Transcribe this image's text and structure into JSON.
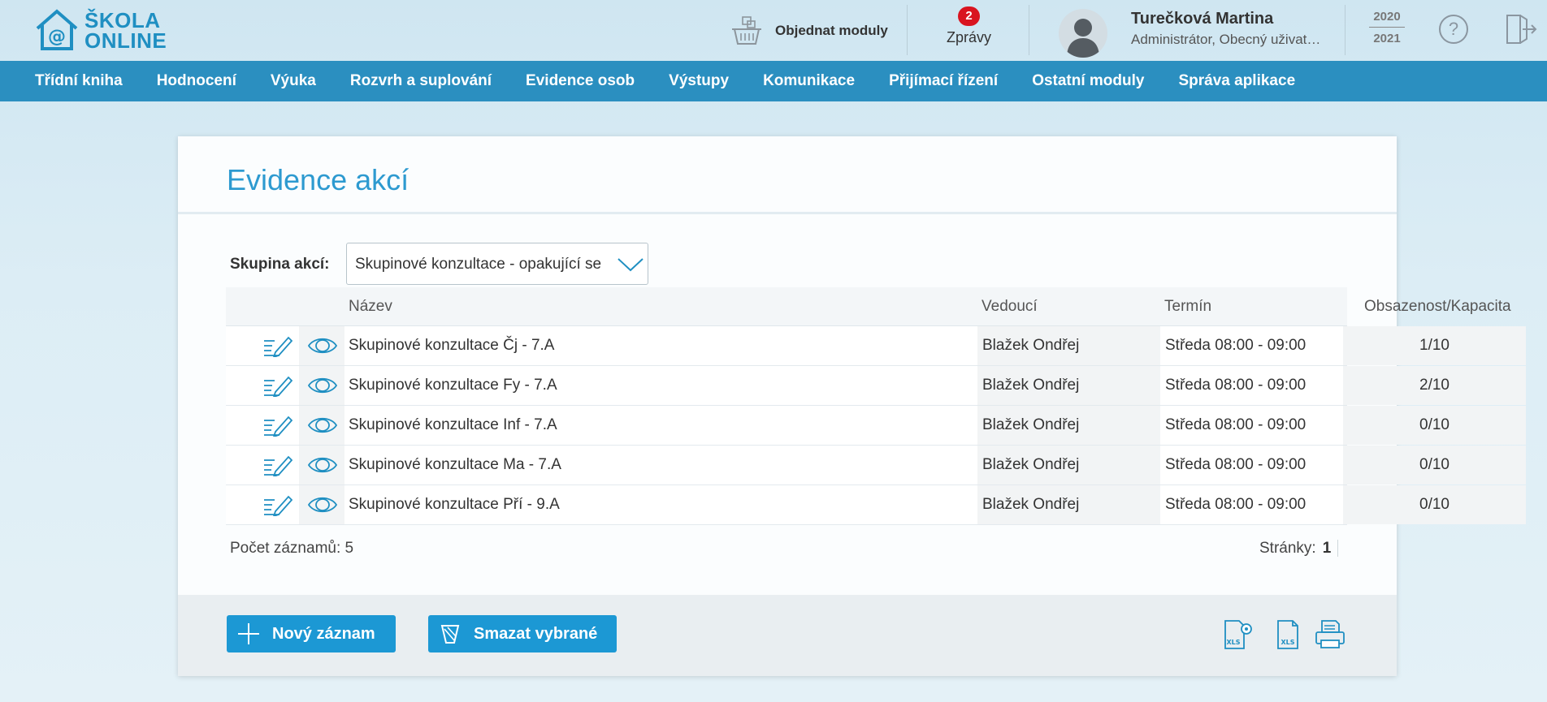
{
  "logo": {
    "line1": "ŠKOLA",
    "line2": "ONLINE"
  },
  "header": {
    "order_label": "Objednat moduly",
    "messages_badge": "2",
    "messages_label": "Zprávy",
    "user_name": "Turečková Martina",
    "user_role": "Administrátor, Obecný uživat…",
    "year_from": "2020",
    "year_to": "2021",
    "help_glyph": "?"
  },
  "nav": {
    "items": [
      "Třídní kniha",
      "Hodnocení",
      "Výuka",
      "Rozvrh a suplování",
      "Evidence osob",
      "Výstupy",
      "Komunikace",
      "Přijímací řízení",
      "Ostatní moduly",
      "Správa aplikace"
    ]
  },
  "page": {
    "title": "Evidence akcí",
    "filter_label": "Skupina akcí:",
    "filter_value": "Skupinové konzultace - opakující se"
  },
  "table": {
    "headers": {
      "name": "Název",
      "leader": "Vedoucí",
      "term": "Termín",
      "capacity": "Obsazenost/Kapacita"
    },
    "rows": [
      {
        "name": "Skupinové konzultace Čj - 7.A",
        "leader": "Blažek Ondřej",
        "term": "Středa 08:00 - 09:00",
        "capacity": "1/10"
      },
      {
        "name": "Skupinové konzultace Fy - 7.A",
        "leader": "Blažek Ondřej",
        "term": "Středa 08:00 - 09:00",
        "capacity": "2/10"
      },
      {
        "name": "Skupinové konzultace Inf - 7.A",
        "leader": "Blažek Ondřej",
        "term": "Středa 08:00 - 09:00",
        "capacity": "0/10"
      },
      {
        "name": "Skupinové konzultace Ma - 7.A",
        "leader": "Blažek Ondřej",
        "term": "Středa 08:00 - 09:00",
        "capacity": "0/10"
      },
      {
        "name": "Skupinové konzultace Pří - 9.A",
        "leader": "Blažek Ondřej",
        "term": "Středa 08:00 - 09:00",
        "capacity": "0/10"
      }
    ]
  },
  "footer": {
    "record_count": "Počet záznamů: 5",
    "pages_label": "Stránky:",
    "pages_current": "1"
  },
  "actions": {
    "new_label": "Nový záznam",
    "delete_label": "Smazat vybrané",
    "export_icons": [
      "xls-settings-icon",
      "xls-icon",
      "print-icon"
    ]
  },
  "colors": {
    "nav_bg": "#2b8fc0",
    "accent": "#1c98d4",
    "title": "#2d9ad0",
    "badge": "#d9141f"
  }
}
